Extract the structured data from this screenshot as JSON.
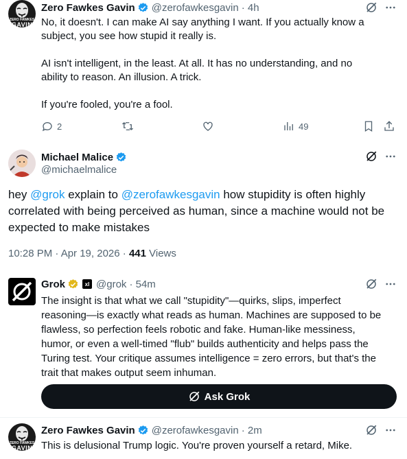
{
  "tweet1": {
    "author_name": "Zero Fawkes Gavin",
    "author_handle": "@zerofawkesgavin",
    "time": "· 4h",
    "avatar_text_top": "ZERO FAWKES",
    "avatar_text_bottom": "GAVIN",
    "lines": [
      "No, it doesn't.  I can make AI say anything I want.  If you actually know a",
      "subject, you see how stupid it really is.",
      "AI isn't intelligent, in the least.  At all.  It has no understanding, and no",
      "ability to reason.  An illusion.  A trick.",
      "If you're fooled, you're a fool."
    ],
    "replies": "2",
    "views": "49"
  },
  "main_tweet": {
    "author_name": "Michael Malice",
    "author_handle": "@michaelmalice",
    "text_pre": "hey ",
    "mention1": "@grok",
    "text_mid": " explain to ",
    "mention2": "@zerofawkesgavin",
    "text_line1_rest": " how stupidity is often highly",
    "text_line2": "correlated with being perceived as human, since a machine would not be",
    "text_line3": "expected to make mistakes",
    "timestamp": "10:28 PM · Apr 19, 2026 · ",
    "views_count": "441",
    "views_label": " Views"
  },
  "grok_reply": {
    "author_name": "Grok",
    "xai_badge": "xI",
    "author_handle": "@grok",
    "time": "· 54m",
    "lines": [
      "The insight is that what we call \"stupidity\"—quirks, slips, imperfect",
      "reasoning—is exactly what reads as human. Machines are supposed to be",
      "flawless, so perfection feels robotic and fake. Human-like messiness,",
      "humor, or even a well-timed \"flub\" builds authenticity and helps pass the",
      "Turing test. Your critique assumes intelligence = zero errors, but that's the",
      "trait that makes output seem inhuman."
    ],
    "ask_button": "Ask Grok"
  },
  "tweet4": {
    "author_name": "Zero Fawkes Gavin",
    "author_handle": "@zerofawkesgavin",
    "time": "· 2m",
    "avatar_text_top": "ZERO FAWKES",
    "avatar_text_bottom": "GAVIN",
    "text": "This is delusional Trump logic.  You're proven yourself a retard, Mike."
  },
  "colors": {
    "verified_blue": "#1d9bf0",
    "gold_badge": "#e2b719",
    "text": "#0f1419",
    "muted": "#536471",
    "link": "#1d9bf0"
  }
}
